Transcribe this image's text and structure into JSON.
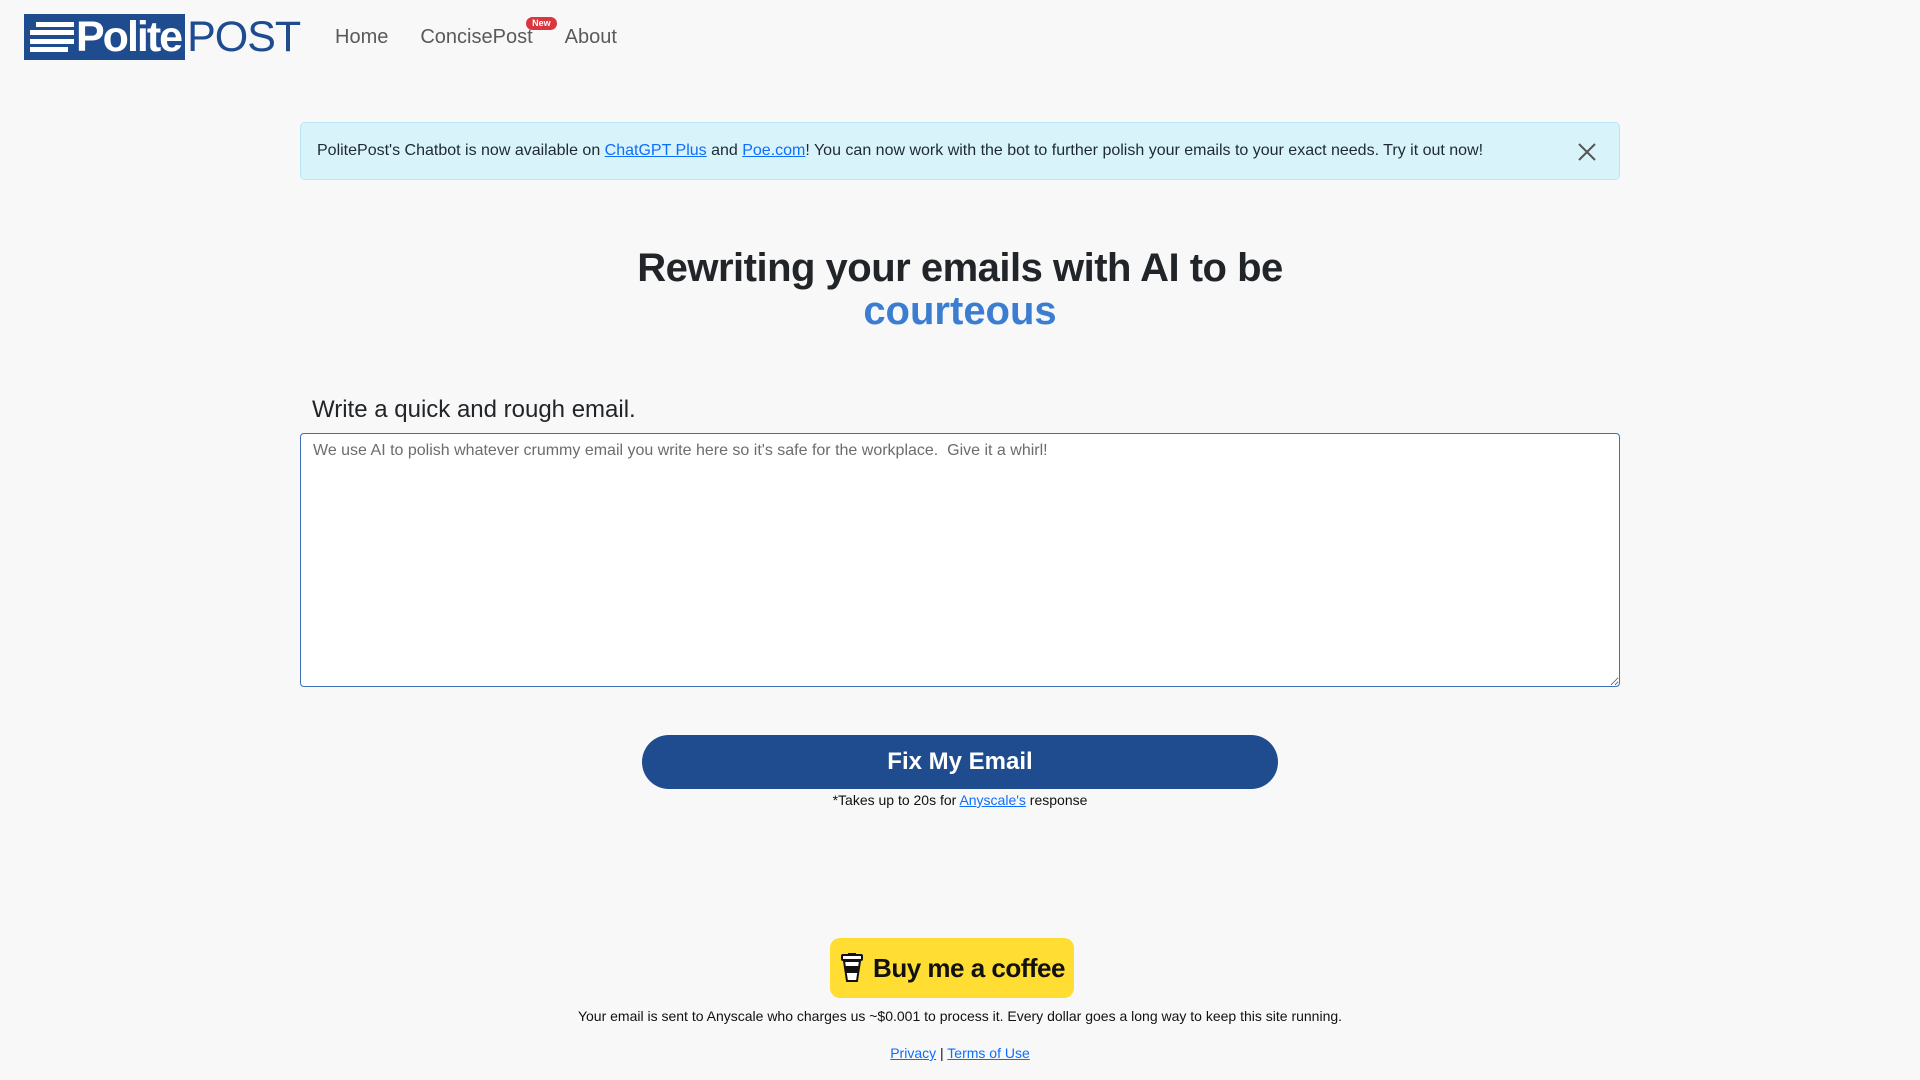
{
  "brand": {
    "logo_part1": "Polite",
    "logo_part2": "POST",
    "color": "#1f4b8f"
  },
  "nav": {
    "items": [
      {
        "label": "Home"
      },
      {
        "label": "ConcisePost",
        "badge": "New"
      },
      {
        "label": "About"
      }
    ]
  },
  "alert": {
    "text_before": "PolitePost's Chatbot is now available on ",
    "link1": "ChatGPT Plus",
    "text_mid": " and ",
    "link2": "Poe.com",
    "text_after": "! You can now work with the bot to further polish your emails to your exact needs. Try it out now!",
    "close_icon": "close-icon",
    "bg_color": "#d9f3fb"
  },
  "hero": {
    "line1": "Rewriting your emails with AI to be",
    "line2": "courteous",
    "accent_color": "#3b7dd0"
  },
  "form": {
    "label": "Write a quick and rough email.",
    "placeholder": "We use AI to polish whatever crummy email you write here so it's safe for the workplace.  Give it a whirl!",
    "value": "",
    "button_label": "Fix My Email",
    "note_before": "*Takes up to 20s for ",
    "note_link": "Anyscale's",
    "note_after": " response"
  },
  "footer": {
    "coffee_label": "Buy me a coffee",
    "coffee_icon": "coffee-cup-icon",
    "coffee_color": "#ffdd33",
    "info": "Your email is sent to Anyscale who charges us ~$0.001 to process it. Every dollar goes a long way to keep this site running.",
    "privacy": "Privacy",
    "separator": " | ",
    "terms": "Terms of Use"
  }
}
